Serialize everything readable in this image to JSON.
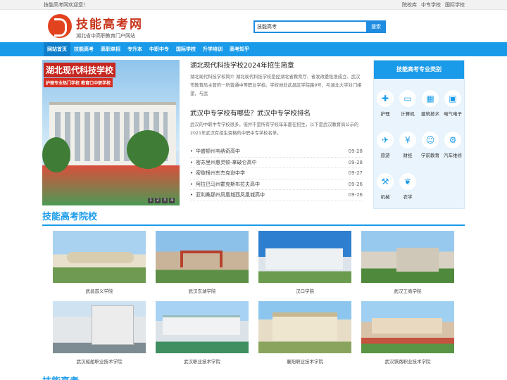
{
  "topbar": {
    "welcome": "技能高考网欢迎您！",
    "links": [
      "院校库",
      "中专学校",
      "国际学校"
    ]
  },
  "header": {
    "logo_title": "技能高考网",
    "logo_subtitle": "湖北省中高职教育门户网站"
  },
  "search": {
    "value": "技能高考",
    "button": "搜索"
  },
  "nav": {
    "items": [
      "网站首页",
      "技能高考",
      "高职单招",
      "专升本",
      "中职中专",
      "国际学校",
      "升学培训",
      "高考知乎"
    ],
    "active_index": 0
  },
  "banner": {
    "title": "湖北现代科技学校",
    "slogan": "护理专业热门学校  教育口中职学校",
    "pager": [
      "1",
      "2",
      "3",
      "4"
    ]
  },
  "news": {
    "article1": {
      "title": "湖北现代科技学校2024年招生简章",
      "summary": "湖北现代科技学校简介 湖北现代科技学校是经湖北省教育厅、省发改委批准成立、武汉市教育局主管的一所普通中等职业学校。学校地处武昌区学院路9号，与湖北大学对门相望，与武"
    },
    "article2": {
      "title": "武汉中专学校有哪些？武汉中专学校排名",
      "summary": "武汉的中职中专学校很多，但并不是所有学校年年都在招生，以下是武汉教育局公示的2021年武汉有招生资格的中职中专学校名单。"
    },
    "list": [
      {
        "title": "华盛顿州韦纳奇高中",
        "date": "09-28"
      },
      {
        "title": "密苏里州惠灵顿-拿破仑高中",
        "date": "09-28"
      },
      {
        "title": "密歇根州东杰克逊中学",
        "date": "09-27"
      },
      {
        "title": "阿拉巴马州霍克斯布拉夫高中",
        "date": "09-26"
      },
      {
        "title": "亚利桑那州凤凰城西凤凰城高中",
        "date": "09-26"
      }
    ]
  },
  "majors": {
    "title": "技能高考专业类别",
    "items": [
      {
        "label": "护理",
        "icon": "nursing-icon"
      },
      {
        "label": "计算机",
        "icon": "computer-icon"
      },
      {
        "label": "建筑技术",
        "icon": "building-icon"
      },
      {
        "label": "电气电子",
        "icon": "chip-icon"
      },
      {
        "label": "旅游",
        "icon": "travel-icon"
      },
      {
        "label": "财经",
        "icon": "finance-icon"
      },
      {
        "label": "学前教育",
        "icon": "preschool-icon"
      },
      {
        "label": "汽车维修",
        "icon": "car-repair-icon"
      },
      {
        "label": "机械",
        "icon": "machinery-icon"
      },
      {
        "label": "农学",
        "icon": "agriculture-icon"
      }
    ]
  },
  "schools": {
    "title": "技能高考院校",
    "items": [
      {
        "name": "武昌首义学院"
      },
      {
        "name": "武汉东湖学院"
      },
      {
        "name": "汉口学院"
      },
      {
        "name": "武汉工商学院"
      },
      {
        "name": "武汉船舶职业技术学院"
      },
      {
        "name": "武汉职业技术学院"
      },
      {
        "name": "襄阳职业技术学院"
      },
      {
        "name": "武汉铁路职业技术学院"
      }
    ]
  },
  "next_section": {
    "title": "技能高考"
  },
  "colors": {
    "primary": "#1a9bea",
    "brand_red": "#c8341b"
  }
}
